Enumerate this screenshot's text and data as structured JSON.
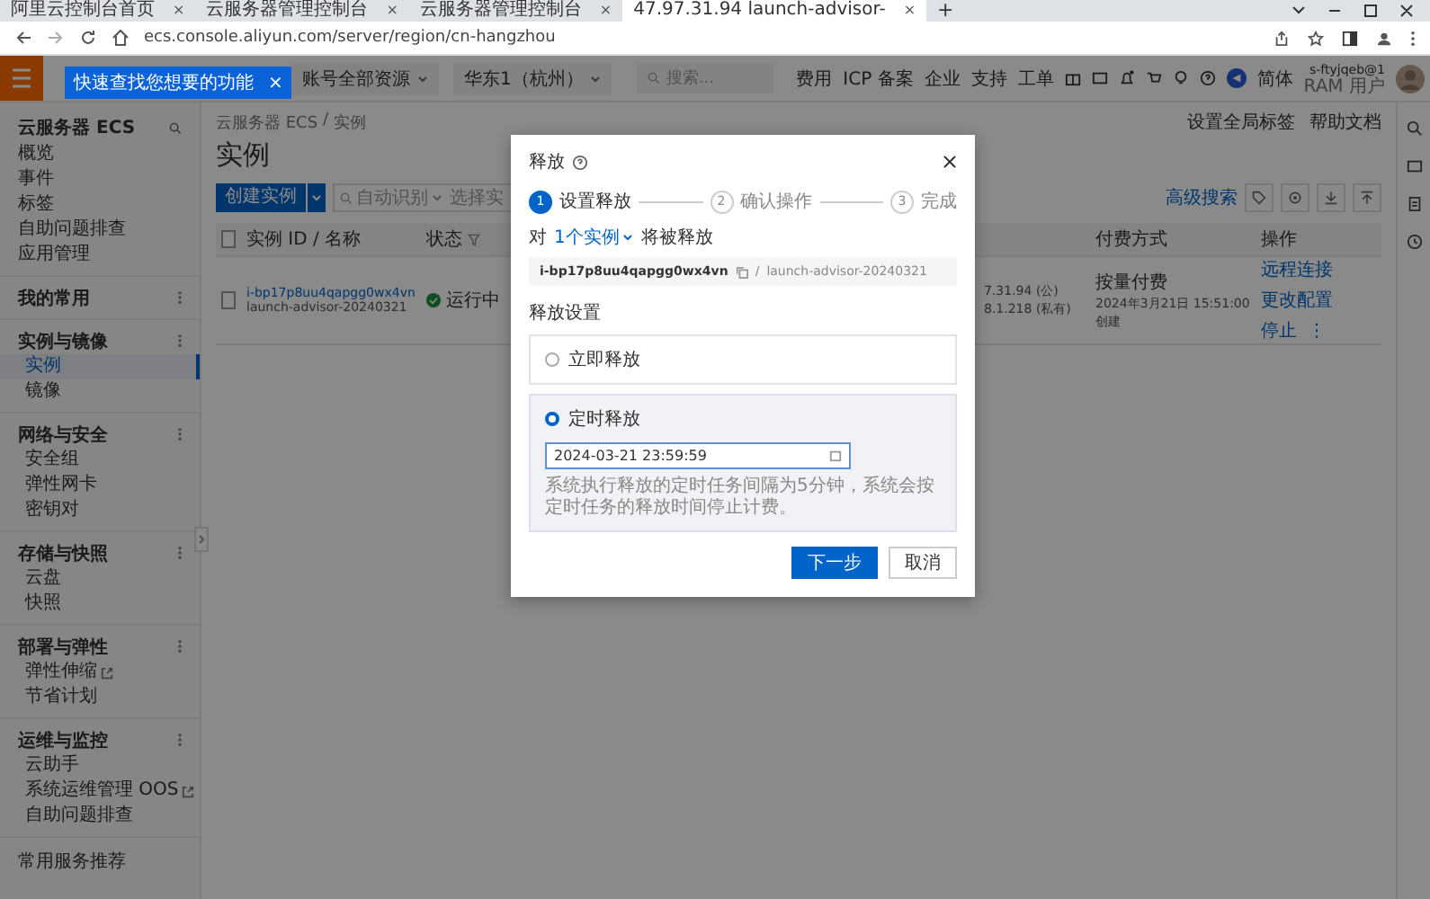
{
  "browser": {
    "tabs": [
      {
        "title": "阿里云控制台首页",
        "close": "×",
        "selected": false
      },
      {
        "title": "云服务器管理控制台",
        "close": "×",
        "selected": false
      },
      {
        "title": "云服务器管理控制台",
        "close": "×",
        "selected": false
      },
      {
        "title": "47.97.31.94 launch-advisor-",
        "close": "×",
        "selected": true
      }
    ],
    "new_tab": "+",
    "address": "ecs.console.aliyun.com/server/region/cn-hangzhou"
  },
  "topbar": {
    "tooltip": "快速查找您想要的功能",
    "tooltip_close": "×",
    "resource_group": "账号全部资源",
    "region": "华东1（杭州）",
    "search_placeholder": "搜索...",
    "links": [
      "费用",
      "ICP 备案",
      "企业",
      "支持",
      "工单"
    ],
    "language": "简体",
    "user": "s-ftyjqeb@1",
    "user_role": "RAM 用户"
  },
  "sidebar": {
    "title": "云服务器 ECS",
    "top_items": [
      {
        "label": "概览",
        "selected": false
      },
      {
        "label": "事件",
        "selected": false
      },
      {
        "label": "标签",
        "selected": false
      },
      {
        "label": "自助问题排查",
        "selected": false
      },
      {
        "label": "应用管理",
        "selected": false
      }
    ],
    "groups": [
      {
        "title": "我的常用"
      },
      {
        "title": "实例与镜像",
        "items": [
          {
            "label": "实例",
            "selected": true,
            "external": false
          },
          {
            "label": "镜像",
            "selected": false,
            "external": false
          }
        ]
      },
      {
        "title": "网络与安全",
        "items": [
          {
            "label": "安全组",
            "selected": false,
            "external": false
          },
          {
            "label": "弹性网卡",
            "selected": false,
            "external": false
          },
          {
            "label": "密钥对",
            "selected": false,
            "external": false
          }
        ]
      },
      {
        "title": "存储与快照",
        "items": [
          {
            "label": "云盘",
            "selected": false,
            "external": false
          },
          {
            "label": "快照",
            "selected": false,
            "external": false
          }
        ]
      },
      {
        "title": "部署与弹性",
        "items": [
          {
            "label": "弹性伸缩",
            "selected": false,
            "external": true
          },
          {
            "label": "节省计划",
            "selected": false,
            "external": false
          }
        ]
      },
      {
        "title": "运维与监控",
        "items": [
          {
            "label": "云助手",
            "selected": false,
            "external": false
          },
          {
            "label": "系统运维管理 OOS",
            "selected": false,
            "external": true
          },
          {
            "label": "自助问题排查",
            "selected": false,
            "external": false
          }
        ]
      }
    ],
    "footer": "常用服务推荐"
  },
  "main": {
    "breadcrumb": [
      "云服务器 ECS",
      "实例"
    ],
    "breadcrumb_separator": "/",
    "title": "实例",
    "header_links": [
      "设置全局标签",
      "帮助文档"
    ],
    "create_button": "创建实例",
    "filter": "自动识别",
    "search_placeholder": "选择实",
    "advanced_search": "高级搜索",
    "table": {
      "columns": [
        "实例 ID / 名称",
        "状态",
        "付费方式",
        "操作"
      ],
      "select_all_checked": false,
      "rows": [
        {
          "checked": false,
          "id": "i-bp17p8uu4qapgg0wx4vn",
          "name": "launch-advisor-20240321",
          "status": "运行中",
          "ip_public": "7.31.94 (公)",
          "ip_private": "8.1.218 (私有)",
          "billing": "按量付费",
          "created": "2024年3月21日 15:51:00创建",
          "actions": [
            "远程连接",
            "更改配置",
            "停止"
          ],
          "more": "⋮"
        }
      ]
    }
  },
  "modal": {
    "title": "释放",
    "steps": [
      {
        "number": "1",
        "label": "设置释放",
        "selected": true
      },
      {
        "number": "2",
        "label": "确认操作",
        "selected": false
      },
      {
        "number": "3",
        "label": "完成",
        "selected": false
      }
    ],
    "scope_prefix": "对",
    "scope_link": "1个实例",
    "scope_suffix": "将被释放",
    "instance_id": "i-bp17p8uu4qapgg0wx4vn",
    "separator": "/",
    "instance_name": "launch-advisor-20240321",
    "section_label": "释放设置",
    "options": [
      {
        "label": "立即释放",
        "selected": false
      },
      {
        "label": "定时释放",
        "selected": true,
        "value": "2024-03-21 23:59:59",
        "hint": "系统执行释放的定时任务间隔为5分钟，系统会按定时任务的释放时间停止计费。"
      }
    ],
    "primary_button": "下一步",
    "cancel_button": "取消"
  }
}
